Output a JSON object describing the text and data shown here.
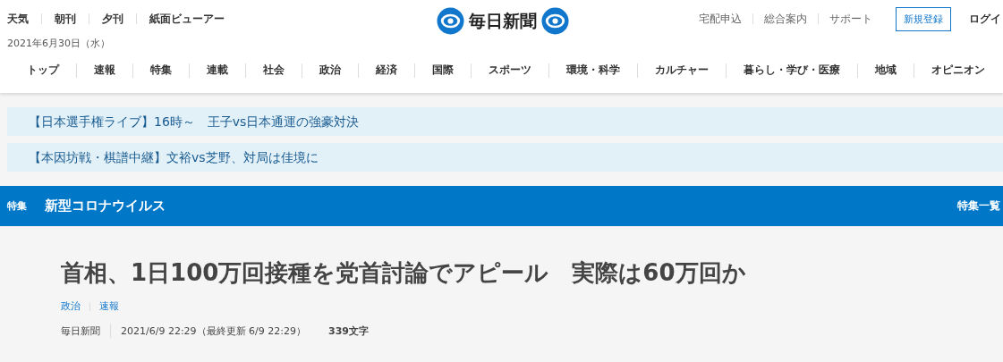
{
  "top_links": [
    "天気",
    "朝刊",
    "夕刊",
    "紙面ビューアー"
  ],
  "date": "2021年6月30日（水）",
  "logo": {
    "text": "毎日新聞"
  },
  "account_links": [
    "宅配申込",
    "総合案内",
    "サポート"
  ],
  "register_button": "新規登録",
  "login_link": "ログイ",
  "nav": [
    {
      "label": "トップ",
      "selected": false
    },
    {
      "label": "速報",
      "selected": false
    },
    {
      "label": "特集",
      "selected": false
    },
    {
      "label": "連載",
      "selected": false
    },
    {
      "label": "社会",
      "selected": false
    },
    {
      "label": "政治",
      "selected": false
    },
    {
      "label": "経済",
      "selected": false
    },
    {
      "label": "国際",
      "selected": false
    },
    {
      "label": "スポーツ",
      "selected": false
    },
    {
      "label": "環境・科学",
      "selected": false
    },
    {
      "label": "カルチャー",
      "selected": false
    },
    {
      "label": "暮らし・学び・医療",
      "selected": false
    },
    {
      "label": "地域",
      "selected": false
    },
    {
      "label": "オピニオン",
      "selected": false
    }
  ],
  "banners": [
    "【日本選手権ライブ】16時～　王子vs日本通運の強豪対決",
    "【本因坊戦・棋譜中継】文裕vs芝野、対局は佳境に"
  ],
  "feature_bar": {
    "label": "特集",
    "title": "新型コロナウイルス",
    "link": "特集一覧"
  },
  "article": {
    "headline": "首相、1日100万回接種を党首討論でアピール　実際は60万回か",
    "categories": [
      "政治",
      "速報"
    ],
    "source": "毎日新聞",
    "timestamp": "2021/6/9 22:29（最終更新 6/9 22:29）",
    "char_count": "339文字"
  }
}
